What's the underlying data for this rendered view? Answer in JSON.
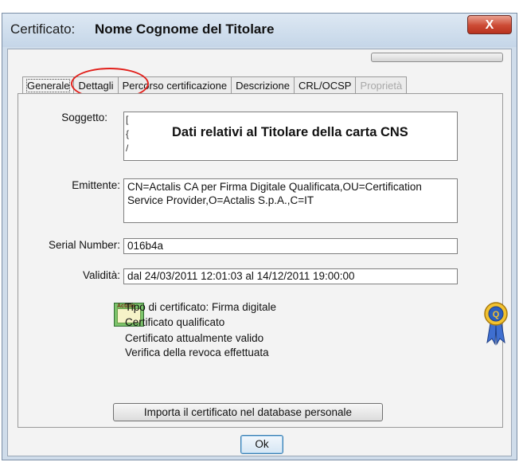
{
  "top_strip": {
    "text": "",
    "link_text": ""
  },
  "window": {
    "title_prefix": "Certificato:",
    "title_name": "Nome Cognome del Titolare",
    "close_label": "X"
  },
  "progress": {
    "value": 0
  },
  "tabs": [
    {
      "label": "Generale",
      "active": true,
      "disabled": false
    },
    {
      "label": "Dettagli",
      "active": false,
      "disabled": false
    },
    {
      "label": "Percorso certificazione",
      "active": false,
      "disabled": false
    },
    {
      "label": "Descrizione",
      "active": false,
      "disabled": false
    },
    {
      "label": "CRL/OCSP",
      "active": false,
      "disabled": false
    },
    {
      "label": "Proprietà",
      "active": false,
      "disabled": true
    }
  ],
  "fields": {
    "soggetto_label": "Soggetto:",
    "soggetto_overlay": "Dati relativi al Titolare della carta CNS",
    "soggetto_fragments": [
      "[",
      "{",
      "/"
    ],
    "emittente_label": "Emittente:",
    "emittente_value": "CN=Actalis CA per Firma Digitale Qualificata,OU=Certification Service Provider,O=Actalis S.p.A.,C=IT",
    "serial_label": "Serial Number:",
    "serial_value": "016b4a",
    "validita_label": "Validità:",
    "validita_value": "dal 24/03/2011 12:01:03 al 14/12/2011 19:00:00"
  },
  "cert_info": {
    "icon_brand": "Actalis",
    "lines": [
      "Tipo di certificato: Firma digitale",
      "Certificato qualificato",
      "Certificato attualmente valido",
      "Verifica della revoca effettuata"
    ]
  },
  "buttons": {
    "import_label": "Importa il certificato nel database personale",
    "ok_label": "Ok"
  },
  "colors": {
    "annotation_red": "#e1211c",
    "window_frame": "#cfdcea",
    "close_button": "#cc4a34"
  }
}
